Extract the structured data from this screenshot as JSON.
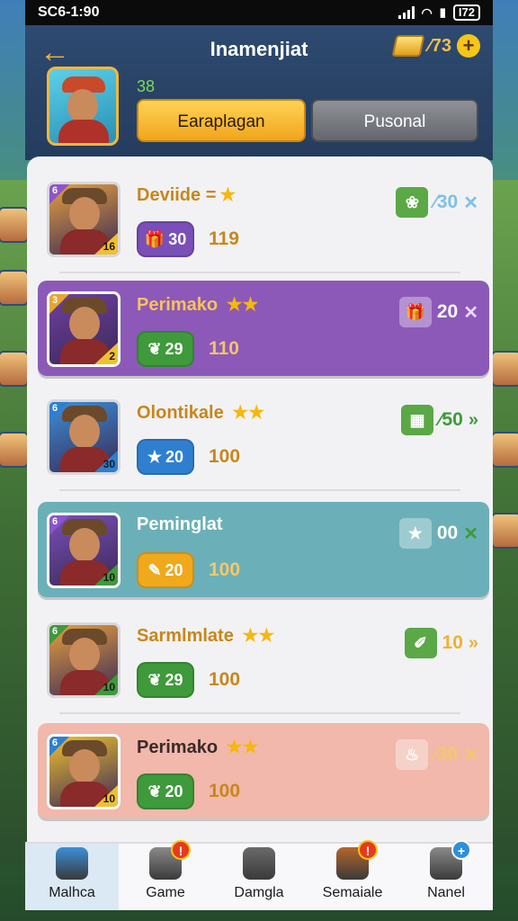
{
  "status_bar": {
    "time": "SC6-1:90",
    "battery": "I72"
  },
  "header": {
    "title": "Inamenjiat",
    "currency": {
      "amount": "⁄73",
      "plus": "+"
    },
    "level": "38",
    "tabs": [
      {
        "label": "Earaplagan",
        "active": true
      },
      {
        "label": "Pusonal",
        "active": false
      }
    ]
  },
  "cards": [
    {
      "name": "Deviide",
      "name_suffix": "=",
      "stars": "★",
      "corner_code": "6",
      "level_tag": "16",
      "pill_value": "30",
      "pill_icon": "gift-icon",
      "value": "119",
      "reward_amount": "⁄30",
      "reward_mark": "✕",
      "reward_icon": "dragon-icon",
      "theme": "plain",
      "colors": {
        "bg": "#f2f2f4",
        "name": "#c8861a",
        "value": "#c8861a",
        "pill": "#7a4fb8",
        "reward": "#7cc1e8",
        "mark": "#7cc1e8",
        "portrait": "#e6a040",
        "corner": "#8b56c9",
        "tag": "#f0c030"
      }
    },
    {
      "name": "Perimako",
      "name_suffix": "",
      "stars": "★★",
      "corner_code": "3",
      "level_tag": "2",
      "pill_value": "29",
      "pill_icon": "shield-icon",
      "value": "110",
      "reward_amount": "20",
      "reward_mark": "✕",
      "reward_icon": "gift-icon",
      "theme": "purple",
      "colors": {
        "bg": "#8c59b8",
        "name": "#f7c35a",
        "value": "#f2c46a",
        "pill": "#3e9a3a",
        "reward": "#ffffff",
        "mark": "#e9d8ff",
        "portrait": "#6f3fa3",
        "corner": "#e8a630",
        "tag": "#f0c030"
      }
    },
    {
      "name": "Olontikale",
      "name_suffix": "",
      "stars": "★★",
      "corner_code": "6",
      "level_tag": "30",
      "pill_value": "20",
      "pill_icon": "star-icon",
      "value": "100",
      "reward_amount": "⁄50",
      "reward_mark": "»",
      "reward_icon": "grid-icon",
      "theme": "plain",
      "colors": {
        "bg": "#f2f2f4",
        "name": "#c8861a",
        "value": "#c8861a",
        "pill": "#2f7fd0",
        "reward": "#3e9a3a",
        "mark": "#3e9a3a",
        "portrait": "#3b8fd8",
        "corner": "#2f7fd0",
        "tag": "#2f7fd0"
      }
    },
    {
      "name": "Peminglat",
      "name_suffix": "",
      "stars": "",
      "corner_code": "6",
      "level_tag": "10",
      "pill_value": "20",
      "pill_icon": "feather-icon",
      "value": "100",
      "reward_amount": "00",
      "reward_mark": "✕",
      "reward_icon": "star-icon",
      "theme": "teal",
      "colors": {
        "bg": "#6bb0b8",
        "name": "#ffffff",
        "value": "#f5c86a",
        "pill": "#f0a81c",
        "reward": "#ffffff",
        "mark": "#3e9a3a",
        "portrait": "#7a4fb8",
        "corner": "#8b56c9",
        "tag": "#3e9a3a"
      }
    },
    {
      "name": "Sarmlmlate",
      "name_suffix": "",
      "stars": "★★",
      "corner_code": "6",
      "level_tag": "10",
      "pill_value": "29",
      "pill_icon": "shield-icon",
      "value": "100",
      "reward_amount": "10",
      "reward_mark": "»",
      "reward_icon": "sword-icon",
      "theme": "plain",
      "colors": {
        "bg": "#f2f2f4",
        "name": "#c8861a",
        "value": "#c8861a",
        "pill": "#3e9a3a",
        "reward": "#f0b030",
        "mark": "#f0b030",
        "portrait": "#e6a040",
        "corner": "#3e9a3a",
        "tag": "#3e9a3a"
      }
    },
    {
      "name": "Perimako",
      "name_suffix": "",
      "stars": "★★",
      "corner_code": "6",
      "level_tag": "10",
      "pill_value": "20",
      "pill_icon": "shield-icon",
      "value": "100",
      "reward_amount": "⁄30",
      "reward_mark": "✕",
      "reward_icon": "potion-icon",
      "theme": "pink",
      "colors": {
        "bg": "#f1b8ab",
        "name": "#3a2a2a",
        "value": "#c8861a",
        "pill": "#3e9a3a",
        "reward": "#f5c86a",
        "mark": "#f5c86a",
        "portrait": "#f0c030",
        "corner": "#2f7fd0",
        "tag": "#f0c030"
      }
    }
  ],
  "nav": [
    {
      "label": "Malhca",
      "icon": "mascot-icon",
      "active": true,
      "badge": ""
    },
    {
      "label": "Game",
      "icon": "chest-icon",
      "active": false,
      "badge": "!"
    },
    {
      "label": "Damgla",
      "icon": "dice-icon",
      "active": false,
      "badge": ""
    },
    {
      "label": "Semaiale",
      "icon": "horn-icon",
      "active": false,
      "badge": "!"
    },
    {
      "label": "Nanel",
      "icon": "wrench-icon",
      "active": false,
      "badge": "+"
    }
  ]
}
